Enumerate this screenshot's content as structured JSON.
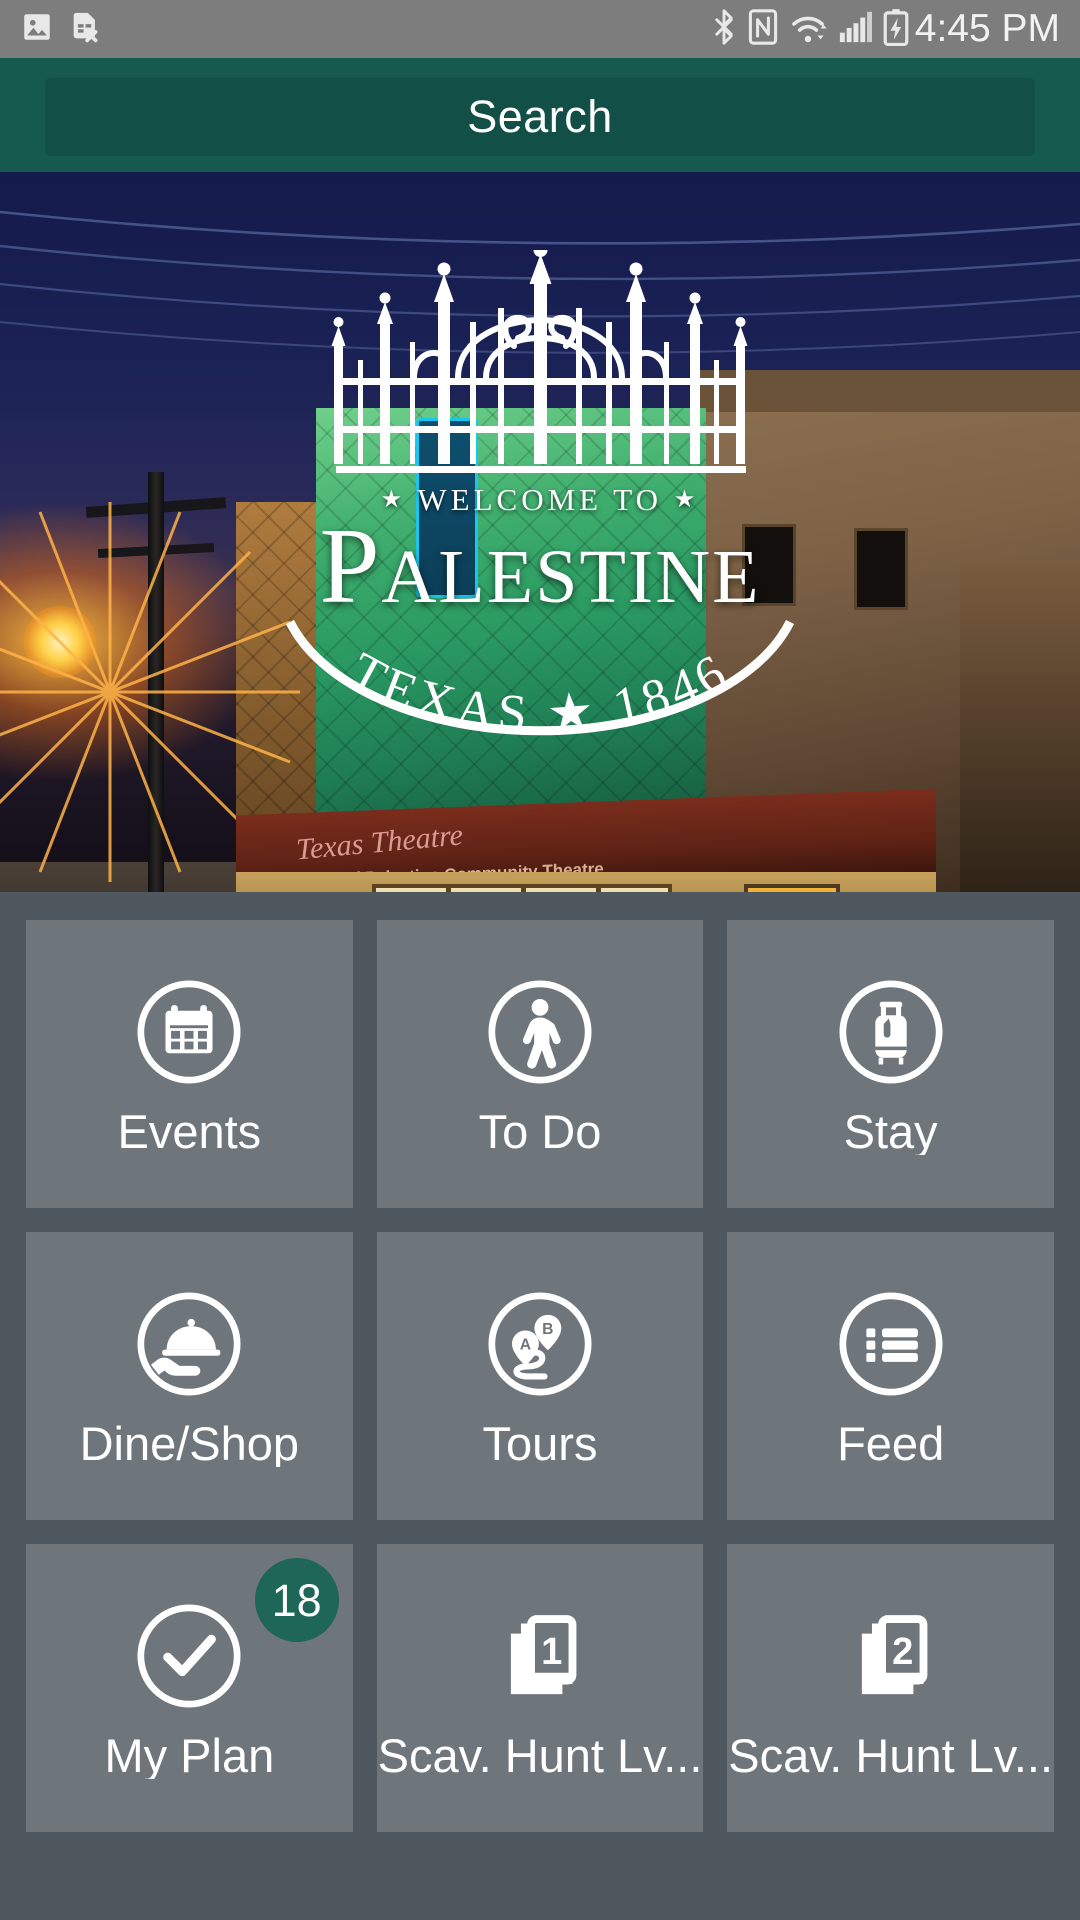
{
  "status_bar": {
    "time": "4:45 PM",
    "left_icons": [
      "image-icon",
      "sim-card-error-icon"
    ],
    "right_icons": [
      "bluetooth-icon",
      "nfc-icon",
      "wifi-icon",
      "cellular-signal-icon",
      "battery-charging-icon"
    ]
  },
  "header": {
    "search_label": "Search",
    "accent_color": "#15594f"
  },
  "hero": {
    "welcome_text": "WELCOME TO",
    "star": "★",
    "city_name": "Palestine",
    "arc_text": "TEXAS ★ 1846",
    "marquee_text": "Texas Theatre",
    "marquee_subtext": "Home of Palestine Community Theatre"
  },
  "grid": {
    "tiles": [
      {
        "label": "Events",
        "icon": "calendar-icon",
        "badge": null
      },
      {
        "label": "To Do",
        "icon": "walking-person-icon",
        "badge": null
      },
      {
        "label": "Stay",
        "icon": "luggage-icon",
        "badge": null
      },
      {
        "label": "Dine/Shop",
        "icon": "room-service-icon",
        "badge": null
      },
      {
        "label": "Tours",
        "icon": "route-pins-icon",
        "badge": null
      },
      {
        "label": "Feed",
        "icon": "list-icon",
        "badge": null
      },
      {
        "label": "My Plan",
        "icon": "check-circle-icon",
        "badge": "18"
      },
      {
        "label": "Scav. Hunt Lv...",
        "icon": "cards-stack-1-icon",
        "badge": null
      },
      {
        "label": "Scav. Hunt Lv...",
        "icon": "cards-stack-2-icon",
        "badge": null
      }
    ],
    "tile_color": "#6f767b",
    "background_color": "#4f575f",
    "badge_color": "#1e6657"
  }
}
